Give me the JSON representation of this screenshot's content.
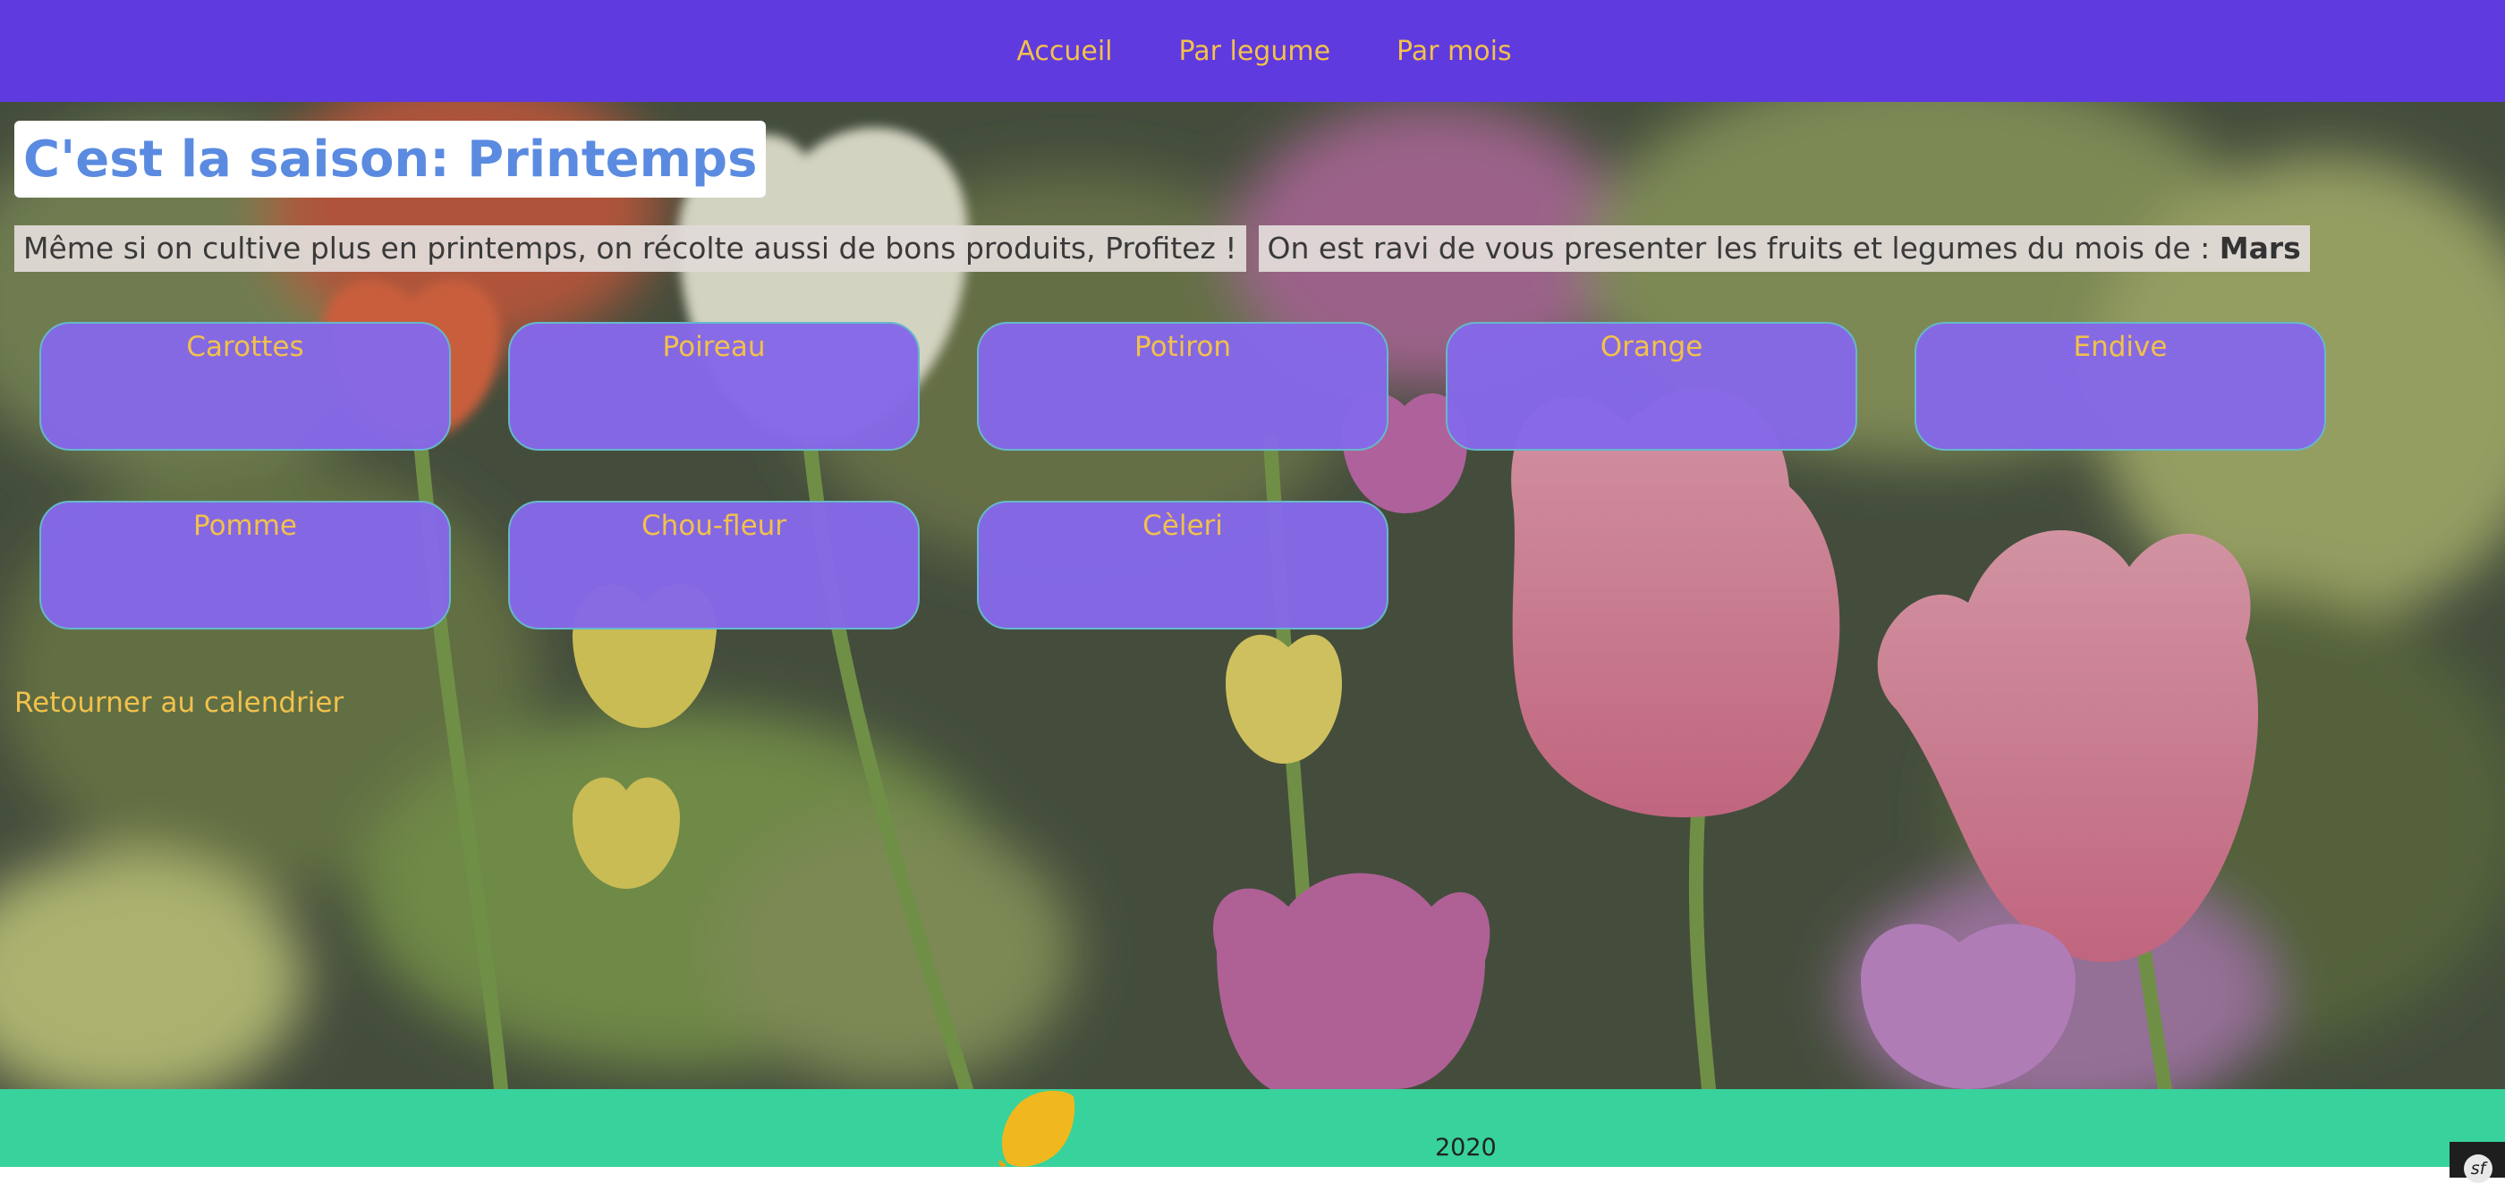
{
  "nav": {
    "items": [
      {
        "label": "Accueil"
      },
      {
        "label": "Par legume"
      },
      {
        "label": "Par mois"
      }
    ]
  },
  "page": {
    "title": "C'est la saison: Printemps",
    "intro_text": "Même si on cultive plus en printemps, on récolte aussi de bons produits, Profitez !",
    "month_intro": "On est ravi de vous presenter les fruits et legumes du mois de :",
    "month": "Mars"
  },
  "vegetables": [
    {
      "name": "Carottes"
    },
    {
      "name": "Poireau"
    },
    {
      "name": "Potiron"
    },
    {
      "name": "Orange"
    },
    {
      "name": "Endive"
    },
    {
      "name": "Pomme"
    },
    {
      "name": "Chou-fleur"
    },
    {
      "name": "Cèleri"
    }
  ],
  "links": {
    "back": "Retourner au calendrier"
  },
  "footer": {
    "year": "2020",
    "icon": "lemon-icon"
  },
  "debug_toolbar": {
    "icon": "symfony-icon",
    "logo_text": "sf"
  },
  "colors": {
    "nav_bg": "#5f3adf",
    "accent_text": "#f2c14b",
    "card_bg": "#8568e8",
    "card_border": "#66b8c9",
    "title_text": "#5a8be0",
    "footer_bg": "#38d29c",
    "lemon": "#f0b81e"
  }
}
